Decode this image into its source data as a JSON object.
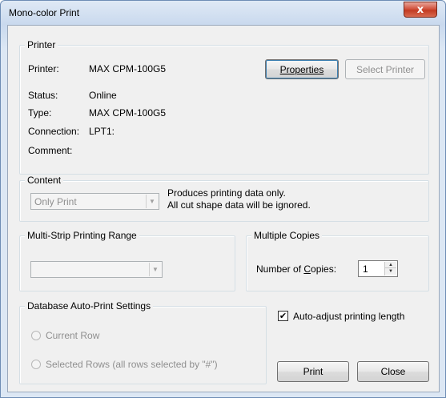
{
  "window": {
    "title": "Mono-color Print",
    "close_glyph": "x"
  },
  "printer_group": {
    "legend": "Printer",
    "printer_label": "Printer:",
    "printer_value": "MAX CPM-100G5",
    "status_label": "Status:",
    "status_value": "Online",
    "type_label": "Type:",
    "type_value": "MAX CPM-100G5",
    "connection_label": "Connection:",
    "connection_value": "LPT1:",
    "comment_label": "Comment:",
    "comment_value": "",
    "properties_button": "Properties",
    "select_printer_button": "Select Printer"
  },
  "content_group": {
    "legend": "Content",
    "combo_value": "Only Print",
    "note_line1": "Produces printing data only.",
    "note_line2": "All cut shape data will be ignored."
  },
  "multistrip_group": {
    "legend": "Multi-Strip Printing Range",
    "combo_value": ""
  },
  "copies_group": {
    "legend": "Multiple Copies",
    "copies_label": "Number of Copies:",
    "copies_value": "1"
  },
  "database_group": {
    "legend": "Database Auto-Print Settings",
    "radio_current_row": "Current Row",
    "radio_selected_rows": "Selected Rows (all rows selected by \"#\")"
  },
  "auto_adjust": {
    "label": "Auto-adjust printing length",
    "checked": true,
    "check_glyph": "✔"
  },
  "buttons": {
    "print": "Print",
    "close": "Close"
  }
}
